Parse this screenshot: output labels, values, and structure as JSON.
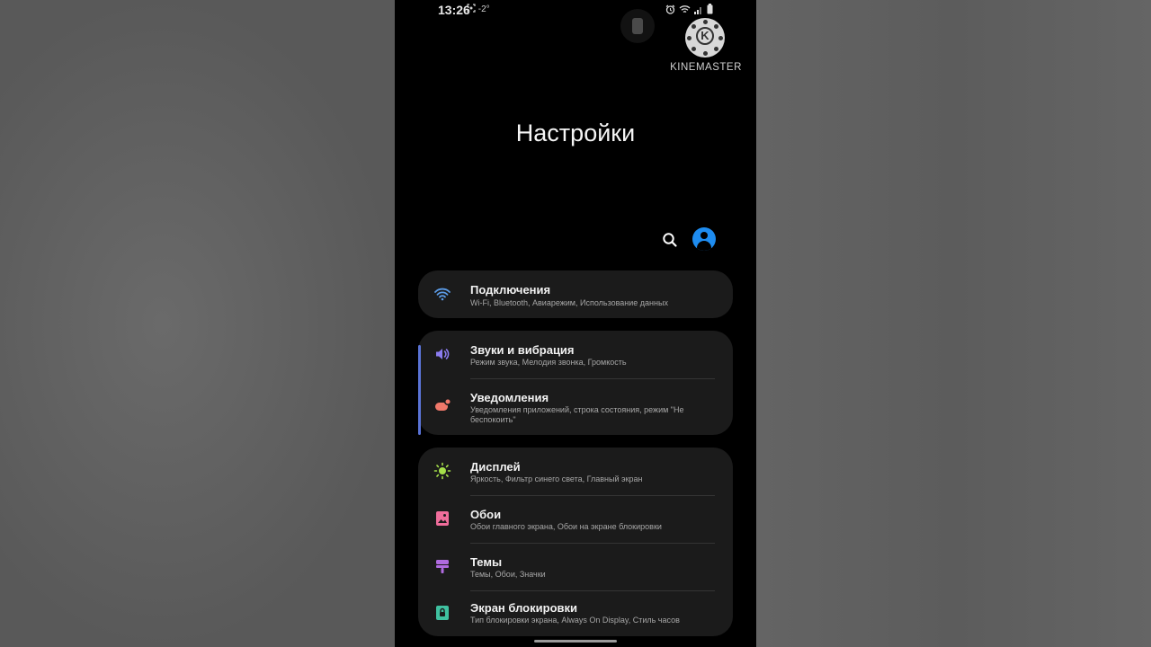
{
  "status_bar": {
    "time": "13:26",
    "extra": "-2°"
  },
  "watermark": {
    "text": "KINEMASTER",
    "logo_letter": "K"
  },
  "page_title": "Настройки",
  "icons": {
    "search": "search-icon",
    "account": "account-icon"
  },
  "groups": [
    {
      "items": [
        {
          "title": "Подключения",
          "subtitle": "Wi-Fi, Bluetooth, Авиарежим, Использование данных",
          "icon": "wifi-icon",
          "color": "#5b9be6"
        }
      ]
    },
    {
      "items": [
        {
          "title": "Звуки и вибрация",
          "subtitle": "Режим звука, Мелодия звонка, Громкость",
          "icon": "volume-icon",
          "color": "#8b7cf0"
        },
        {
          "title": "Уведомления",
          "subtitle": "Уведомления приложений, строка состояния, режим \"Не беспокоить\"",
          "icon": "notification-icon",
          "color": "#f0786a"
        }
      ]
    },
    {
      "items": [
        {
          "title": "Дисплей",
          "subtitle": "Яркость, Фильтр синего света, Главный экран",
          "icon": "brightness-icon",
          "color": "#a5e04a"
        },
        {
          "title": "Обои",
          "subtitle": "Обои главного экрана, Обои на экране блокировки",
          "icon": "wallpaper-icon",
          "color": "#f06d9b"
        },
        {
          "title": "Темы",
          "subtitle": "Темы, Обои, Значки",
          "icon": "themes-icon",
          "color": "#b06be0"
        },
        {
          "title": "Экран блокировки",
          "subtitle": "Тип блокировки экрана, Always On Display, Стиль часов",
          "icon": "lock-icon",
          "color": "#3fc1a0"
        }
      ]
    }
  ],
  "colors": {
    "background": "#000000",
    "card": "#1b1b1b",
    "accent_bar": "#5a73d6",
    "account": "#1e8cf0"
  }
}
